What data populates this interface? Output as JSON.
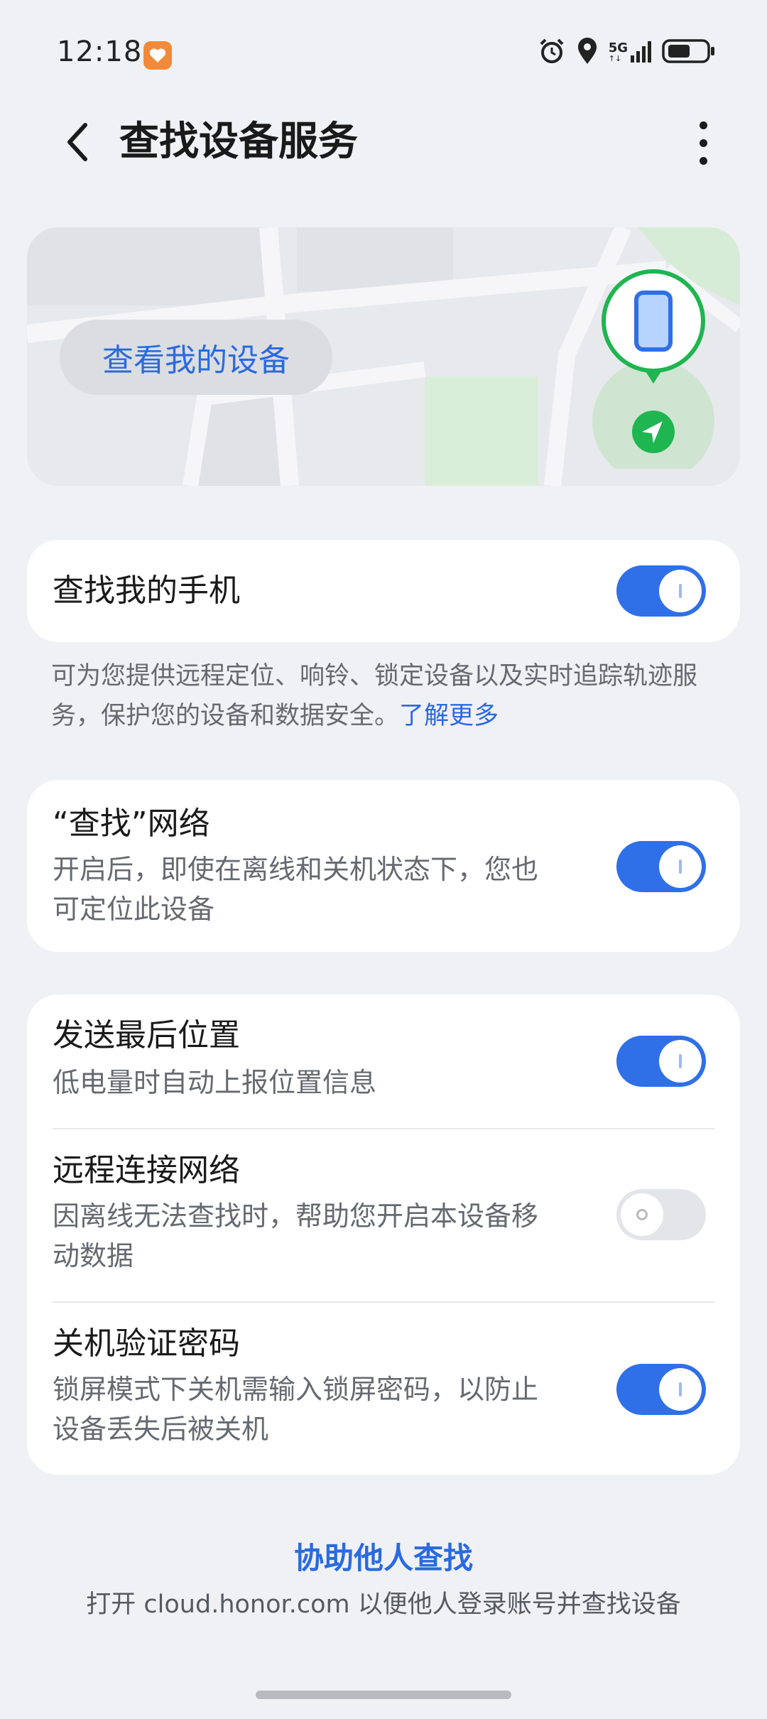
{
  "status_bar": {
    "time": "12:18",
    "network_label": "5G",
    "icons": [
      "alarm-icon",
      "location-icon",
      "signal-icon",
      "battery-icon"
    ],
    "battery_percent": 55
  },
  "header": {
    "title": "查找设备服务",
    "back_icon": "back-arrow-icon",
    "more_icon": "more-vertical-icon"
  },
  "map_card": {
    "button_label": "查看我的设备",
    "pin_icon": "phone-icon",
    "locate_icon": "navigation-arrow-icon"
  },
  "find_my_phone": {
    "title": "查找我的手机",
    "enabled": true
  },
  "find_description": {
    "text": "可为您提供远程定位、响铃、锁定设备以及实时追踪轨迹服务，保护您的设备和数据安全。",
    "link": "了解更多"
  },
  "find_network": {
    "title": "“查找”网络",
    "subtitle": "开启后，即使在离线和关机状态下，您也可定位此设备",
    "enabled": true
  },
  "settings": [
    {
      "title": "发送最后位置",
      "subtitle": "低电量时自动上报位置信息",
      "enabled": true
    },
    {
      "title": "远程连接网络",
      "subtitle": "因离线无法查找时，帮助您开启本设备移动数据",
      "enabled": false
    },
    {
      "title": "关机验证密码",
      "subtitle": "锁屏模式下关机需输入锁屏密码，以防止设备丢失后被关机",
      "enabled": true
    }
  ],
  "assist": {
    "link": "协助他人查找",
    "subtitle": "打开 cloud.honor.com 以便他人登录账号并查找设备"
  },
  "colors": {
    "accent": "#2f6fe8",
    "link": "#2a6ae0",
    "background": "#f0f1f5",
    "pin_green": "#1fb550"
  }
}
